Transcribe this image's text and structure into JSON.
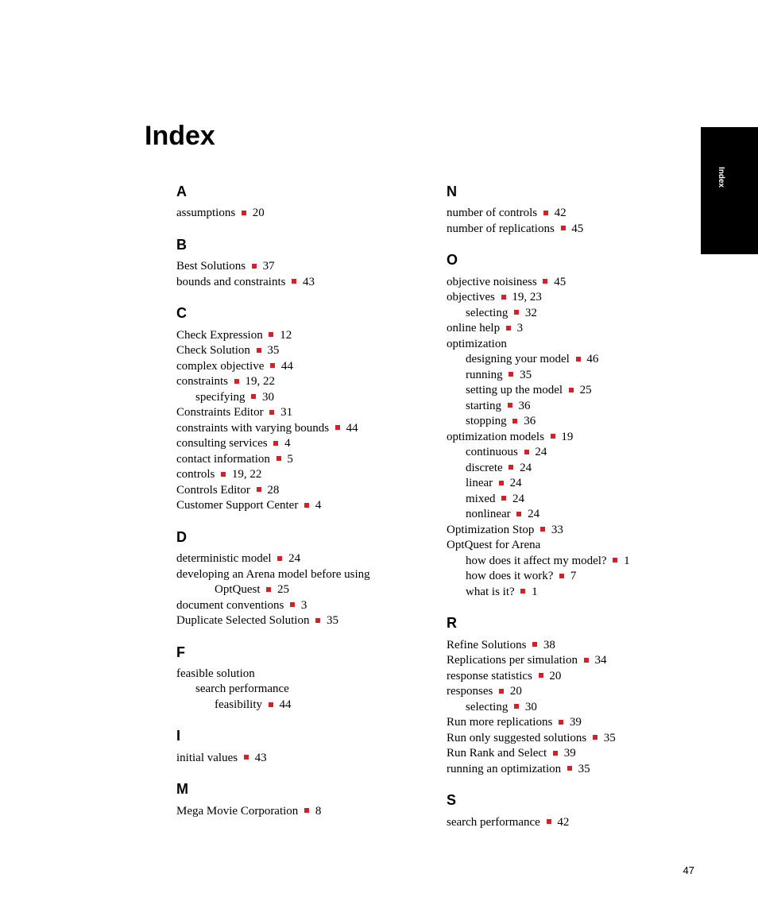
{
  "title": "Index",
  "thumb_tab": "Index",
  "page_number": "47",
  "left_sections": [
    {
      "letter": "A",
      "rows": [
        {
          "text": "assumptions",
          "pages": "20"
        }
      ]
    },
    {
      "letter": "B",
      "rows": [
        {
          "text": "Best Solutions",
          "pages": "37"
        },
        {
          "text": "bounds and constraints",
          "pages": "43"
        }
      ]
    },
    {
      "letter": "C",
      "rows": [
        {
          "text": "Check Expression",
          "pages": "12"
        },
        {
          "text": "Check Solution",
          "pages": "35"
        },
        {
          "text": "complex objective",
          "pages": "44"
        },
        {
          "text": "constraints",
          "pages": "19, 22"
        },
        {
          "indent": 1,
          "text": "specifying",
          "pages": "30"
        },
        {
          "text": "Constraints Editor",
          "pages": "31"
        },
        {
          "text": "constraints with varying bounds",
          "pages": "44"
        },
        {
          "text": "consulting services",
          "pages": "4"
        },
        {
          "text": "contact information",
          "pages": "5"
        },
        {
          "text": "controls",
          "pages": "19, 22"
        },
        {
          "text": "Controls Editor",
          "pages": "28"
        },
        {
          "text": "Customer Support Center",
          "pages": "4"
        }
      ]
    },
    {
      "letter": "D",
      "rows": [
        {
          "text": "deterministic model",
          "pages": "24"
        },
        {
          "text": "developing an Arena model before using"
        },
        {
          "indent": 2,
          "text": "OptQuest",
          "pages": "25"
        },
        {
          "text": "document conventions",
          "pages": "3"
        },
        {
          "text": "Duplicate Selected Solution",
          "pages": "35"
        }
      ]
    },
    {
      "letter": "F",
      "rows": [
        {
          "text": "feasible solution"
        },
        {
          "indent": 1,
          "text": "search performance"
        },
        {
          "indent": 2,
          "text": "feasibility",
          "pages": "44"
        }
      ]
    },
    {
      "letter": "I",
      "rows": [
        {
          "text": "initial values",
          "pages": "43"
        }
      ]
    },
    {
      "letter": "M",
      "rows": [
        {
          "text": "Mega Movie Corporation",
          "pages": "8"
        }
      ]
    }
  ],
  "right_sections": [
    {
      "letter": "N",
      "rows": [
        {
          "text": "number of controls",
          "pages": "42"
        },
        {
          "text": "number of replications",
          "pages": "45"
        }
      ]
    },
    {
      "letter": "O",
      "rows": [
        {
          "text": "objective noisiness",
          "pages": "45"
        },
        {
          "text": "objectives",
          "pages": "19, 23"
        },
        {
          "indent": 1,
          "text": "selecting",
          "pages": "32"
        },
        {
          "text": "online help",
          "pages": "3"
        },
        {
          "text": "optimization"
        },
        {
          "indent": 1,
          "text": "designing your model",
          "pages": "46"
        },
        {
          "indent": 1,
          "text": "running",
          "pages": "35"
        },
        {
          "indent": 1,
          "text": "setting up the model",
          "pages": "25"
        },
        {
          "indent": 1,
          "text": "starting",
          "pages": "36"
        },
        {
          "indent": 1,
          "text": "stopping",
          "pages": "36"
        },
        {
          "text": "optimization models",
          "pages": "19"
        },
        {
          "indent": 1,
          "text": "continuous",
          "pages": "24"
        },
        {
          "indent": 1,
          "text": "discrete",
          "pages": "24"
        },
        {
          "indent": 1,
          "text": "linear",
          "pages": "24"
        },
        {
          "indent": 1,
          "text": "mixed",
          "pages": "24"
        },
        {
          "indent": 1,
          "text": "nonlinear",
          "pages": "24"
        },
        {
          "text": "Optimization Stop",
          "pages": "33"
        },
        {
          "text": "OptQuest for Arena"
        },
        {
          "indent": 1,
          "text": "how does it affect my model?",
          "pages": "1"
        },
        {
          "indent": 1,
          "text": "how does it work?",
          "pages": "7"
        },
        {
          "indent": 1,
          "text": "what is it?",
          "pages": "1"
        }
      ]
    },
    {
      "letter": "R",
      "rows": [
        {
          "text": "Refine Solutions",
          "pages": "38"
        },
        {
          "text": "Replications per simulation",
          "pages": "34"
        },
        {
          "text": "response statistics",
          "pages": "20"
        },
        {
          "text": "responses",
          "pages": "20"
        },
        {
          "indent": 1,
          "text": "selecting",
          "pages": "30"
        },
        {
          "text": "Run more replications",
          "pages": "39"
        },
        {
          "text": "Run only suggested solutions",
          "pages": "35"
        },
        {
          "text": "Run Rank and Select",
          "pages": "39"
        },
        {
          "text": "running an optimization",
          "pages": "35"
        }
      ]
    },
    {
      "letter": "S",
      "rows": [
        {
          "text": "search performance",
          "pages": "42"
        }
      ]
    }
  ]
}
